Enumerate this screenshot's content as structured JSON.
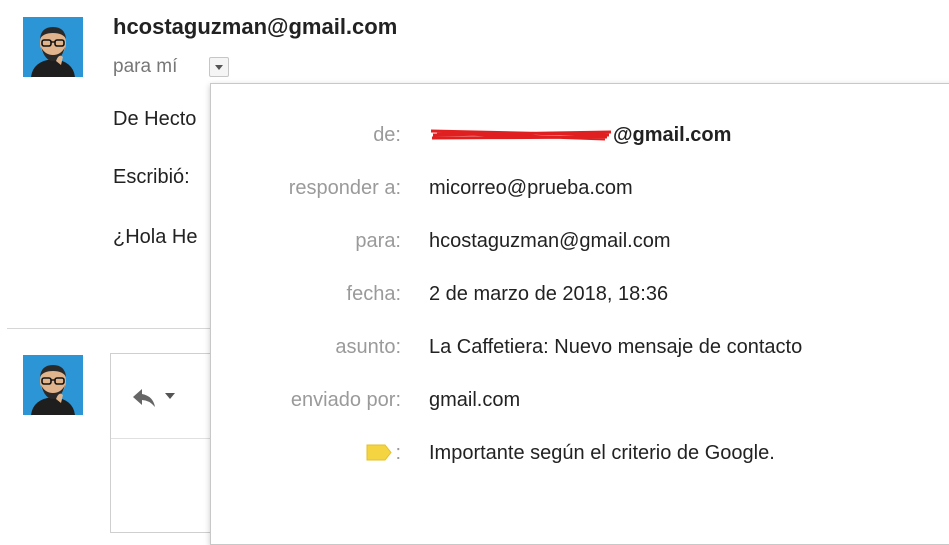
{
  "header": {
    "sender": "hcostaguzman@gmail.com",
    "recipient_label": "para mí"
  },
  "body_lines": [
    "De Hecto",
    "Escribió:",
    "¿Hola He"
  ],
  "details": {
    "rows": [
      {
        "label": "de:",
        "value": "@gmail.com"
      },
      {
        "label": "responder a:",
        "value": "micorreo@prueba.com"
      },
      {
        "label": "para:",
        "value": "hcostaguzman@gmail.com"
      },
      {
        "label": "fecha:",
        "value": "2 de marzo de 2018, 18:36"
      },
      {
        "label": "asunto:",
        "value": "La Caffetiera: Nuevo mensaje de contacto"
      },
      {
        "label": "enviado por:",
        "value": "gmail.com"
      },
      {
        "label": ":",
        "value": "Importante según el criterio de Google."
      }
    ]
  },
  "icons": {
    "avatar": "cartoon-man-avatar",
    "toggle": "chevron-down-icon",
    "reply": "reply-arrow-icon",
    "importance": "importance-marker-icon"
  },
  "colors": {
    "avatar_bg": "#2b95d6",
    "redaction": "#e02020",
    "importance": "#f5d442"
  }
}
